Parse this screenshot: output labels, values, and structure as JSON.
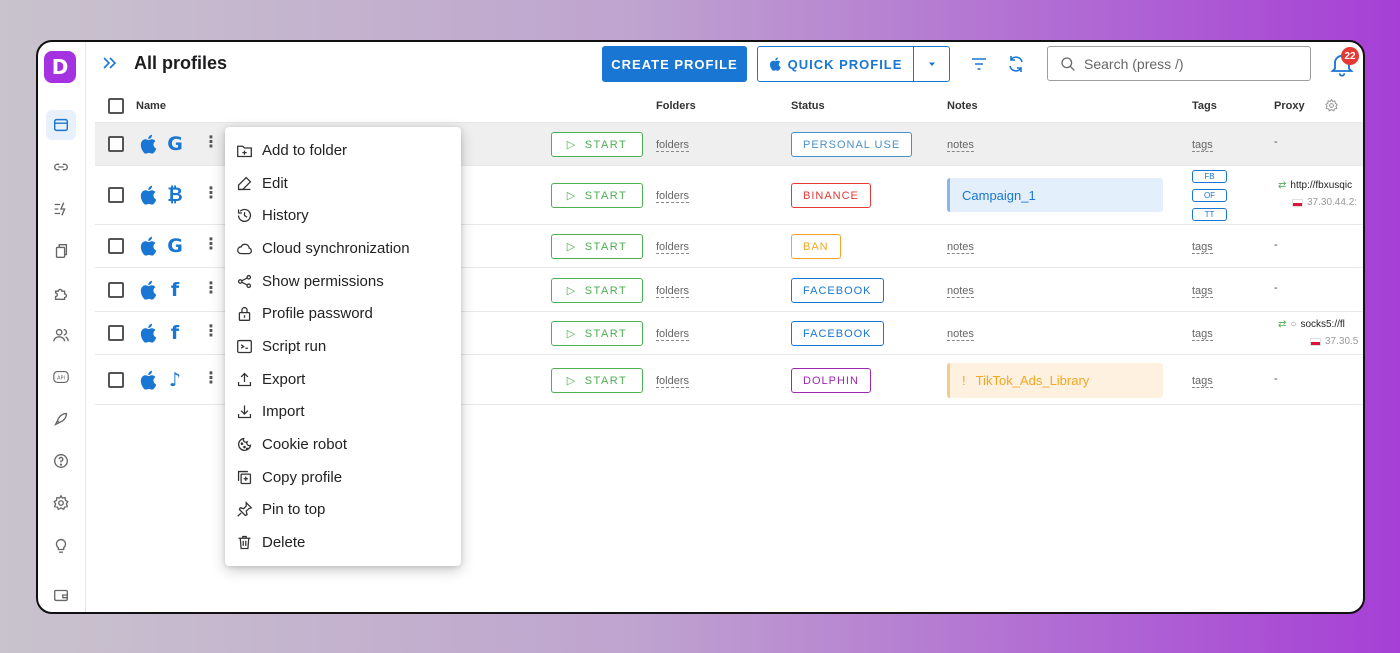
{
  "header": {
    "title": "All profiles",
    "create_label": "CREATE PROFILE",
    "quick_label": "QUICK PROFILE",
    "search_placeholder": "Search (press /)",
    "notification_count": "22"
  },
  "table": {
    "columns": {
      "name": "Name",
      "folders": "Folders",
      "status": "Status",
      "notes": "Notes",
      "tags": "Tags",
      "proxy": "Proxy"
    },
    "start_label": "START",
    "rows": [
      {
        "brand": "G",
        "folders": "folders",
        "status": "PERSONAL USE",
        "status_color": "#4a90c8",
        "notes": "notes",
        "tags": "tags",
        "proxy": "-"
      },
      {
        "brand": "₿",
        "folders": "folders",
        "status": "BINANCE",
        "status_color": "#e53935",
        "notes": "Campaign_1",
        "tag_chips": [
          "FB",
          "OF",
          "TT"
        ],
        "proxy_url": "http://fbxusqic",
        "proxy_ip": "37.30.44.2:"
      },
      {
        "brand": "G",
        "folders": "folders",
        "status": "BAN",
        "status_color": "#f5a623",
        "notes": "notes",
        "tags": "tags",
        "proxy": "-"
      },
      {
        "brand": "f",
        "folders": "folders",
        "status": "FACEBOOK",
        "status_color": "#1976d2",
        "notes": "notes",
        "tags": "tags",
        "proxy": "-"
      },
      {
        "brand": "f",
        "folders": "folders",
        "status": "FACEBOOK",
        "status_color": "#1976d2",
        "notes": "notes",
        "tags": "tags",
        "proxy_url": "socks5://fl",
        "proxy_ip": "37.30.5"
      },
      {
        "brand": "♪",
        "folders": "folders",
        "status": "DOLPHIN",
        "status_color": "#9c27b0",
        "notes": "TikTok_Ads_Library",
        "notes_prefix": "!",
        "tags": "tags",
        "proxy": "-"
      }
    ]
  },
  "context_menu": {
    "items": [
      {
        "label": "Add to folder",
        "icon": "folder-add-icon"
      },
      {
        "label": "Edit",
        "icon": "edit-icon"
      },
      {
        "label": "History",
        "icon": "history-icon"
      },
      {
        "label": "Cloud synchronization",
        "icon": "cloud-icon"
      },
      {
        "label": "Show permissions",
        "icon": "share-icon"
      },
      {
        "label": "Profile password",
        "icon": "lock-icon"
      },
      {
        "label": "Script run",
        "icon": "terminal-icon"
      },
      {
        "label": "Export",
        "icon": "upload-icon"
      },
      {
        "label": "Import",
        "icon": "download-icon"
      },
      {
        "label": "Cookie robot",
        "icon": "cookie-icon"
      },
      {
        "label": "Copy profile",
        "icon": "copy-icon"
      },
      {
        "label": "Pin to top",
        "icon": "pin-icon"
      },
      {
        "label": "Delete",
        "icon": "trash-icon"
      }
    ]
  },
  "colors": {
    "primary": "#1976d2",
    "start_green": "#4caf50",
    "logo": "#a532e0",
    "badge": "#e53935"
  }
}
